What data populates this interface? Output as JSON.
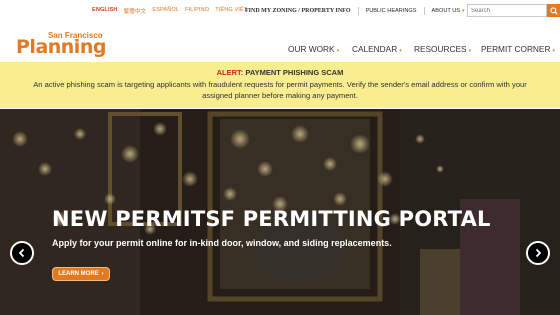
{
  "languages": [
    "ENGLISH",
    "繁體中文",
    "ESPAÑOL",
    "FILIPINO",
    "TIẾNG VIỆT"
  ],
  "top_links": {
    "find_zoning": "FIND MY ZONING / PROPERTY INFO",
    "public_hearings": "PUBLIC HEARINGS",
    "about_us": "ABOUT US"
  },
  "search": {
    "placeholder": "Search"
  },
  "logo": {
    "small": "San Francisco",
    "big": "Planning"
  },
  "nav": [
    "OUR WORK",
    "CALENDAR",
    "RESOURCES",
    "PERMIT CORNER"
  ],
  "alert": {
    "label": "ALERT:",
    "title": "PAYMENT PHISHING SCAM",
    "message": "An active phishing scam is targeting applicants with fraudulent requests for permit payments. Verify the sender's email address or confirm with your assigned planner before making any payment."
  },
  "hero": {
    "title": "NEW PERMITSF PERMITTING PORTAL",
    "subtitle": "Apply for your permit online for in-kind door, window, and siding replacements.",
    "button": "LEARN MORE"
  },
  "colors": {
    "brand_orange": "#e07b24",
    "alert_bg": "#f8ee8f",
    "alert_red": "#c8251e"
  },
  "icons": [
    "search-icon",
    "chevron-down-icon",
    "chevron-left-icon",
    "chevron-right-icon"
  ]
}
